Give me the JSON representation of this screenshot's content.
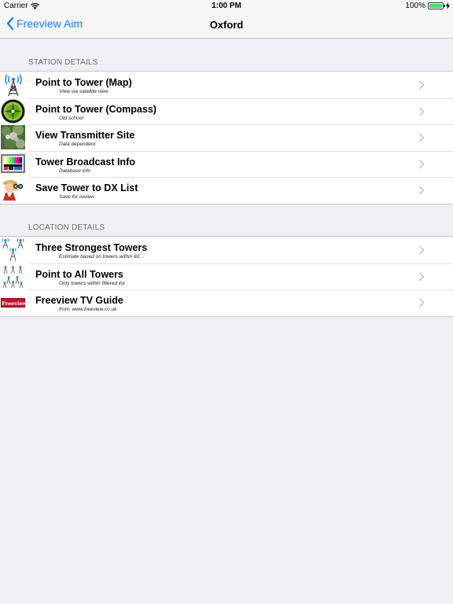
{
  "status_bar": {
    "carrier": "Carrier",
    "time": "1:00 PM",
    "battery": "100%"
  },
  "nav": {
    "back_label": "Freeview Aim",
    "title": "Oxford"
  },
  "sections": [
    {
      "header": "STATION DETAILS",
      "rows": [
        {
          "title": "Point to Tower (Map)",
          "subtitle": "View via satellite view",
          "icon": "radio-tower-icon"
        },
        {
          "title": "Point to Tower (Compass)",
          "subtitle": "Old school",
          "icon": "compass-icon"
        },
        {
          "title": "View Transmitter Site",
          "subtitle": "Data dependent",
          "icon": "transmitter-photo-icon"
        },
        {
          "title": "Tower Broadcast Info",
          "subtitle": "Database info",
          "icon": "test-card-icon"
        },
        {
          "title": "Save Tower to DX List",
          "subtitle": "Save for review",
          "icon": "explorer-binoculars-icon"
        }
      ]
    },
    {
      "header": "LOCATION DETAILS",
      "rows": [
        {
          "title": "Three Strongest Towers",
          "subtitle": "Estimate based on towers within 60...",
          "icon": "three-towers-icon"
        },
        {
          "title": "Point to All Towers",
          "subtitle": "Only towers within filtered list",
          "icon": "all-towers-icon"
        },
        {
          "title": "Freeview TV Guide",
          "subtitle": "from: www.freeview.co.uk",
          "icon": "freeview-logo-icon",
          "logo_text": "Freeview"
        }
      ]
    }
  ],
  "colors": {
    "tint": "#147efb",
    "background": "#efeff4",
    "separator": "#c8c7cc"
  }
}
